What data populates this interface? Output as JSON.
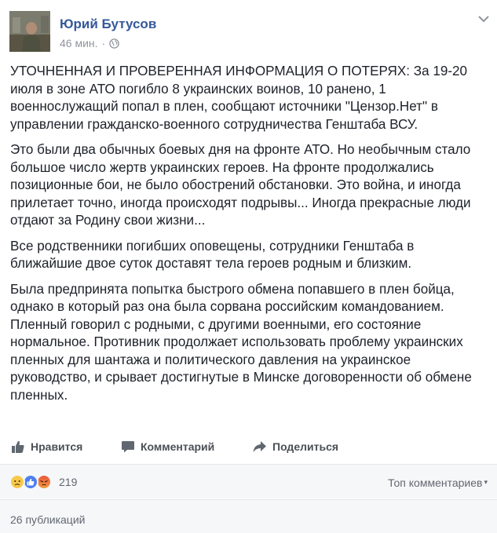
{
  "post": {
    "author": "Юрий Бутусов",
    "time": "46 мин.",
    "separator": "·",
    "privacy_icon": "globe-icon",
    "paragraphs": [
      "УТОЧНЕННАЯ И ПРОВЕРЕННАЯ ИНФОРМАЦИЯ О ПОТЕРЯХ: За 19-20 июля в зоне АТО погибло 8 украинских воинов, 10 ранено, 1 военнослужащий попал в плен, сообщают источники \"Цензор.Нет\" в управлении гражданско-военного сотрудничества Генштаба ВСУ.",
      "Это были два обычных боевых дня на фронте АТО. Но необычным стало большое число жертв украинских героев. На фронте продолжались позиционные бои, не было обострений обстановки. Это война, и иногда прилетает точно, иногда происходят подрывы... Иногда прекрасные люди отдают за Родину свои жизни...",
      "Все родственники погибших оповещены, сотрудники Генштаба в ближайшие двое суток доставят тела героев родным и близким.",
      "Была предпринята попытка быстрого обмена попавшего в плен бойца, однако в который раз она была сорвана российским командованием. Пленный говорил с родными, с другими военными, его состояние нормальное. Противник продолжает использовать проблему украинских пленных для шантажа и политического давления на украинское руководство, и срывает достигнутые в Минске договоренности об обмене пленных."
    ]
  },
  "actions": {
    "like": "Нравится",
    "comment": "Комментарий",
    "share": "Поделиться"
  },
  "reactions": {
    "icons": [
      "sad-reaction-icon",
      "like-reaction-icon",
      "angry-reaction-icon"
    ],
    "count": "219",
    "sort_label": "Топ комментариев",
    "sort_caret": "▾"
  },
  "shares": {
    "label": "26 публикаций"
  },
  "colors": {
    "author": "#365899",
    "text": "#1d2129",
    "muted": "#90949c",
    "like_blue": "#4d7ff0",
    "sad_yellow": "#f7c94b",
    "angry_red": "#e9573c",
    "footer_bg": "#f6f7f9"
  }
}
